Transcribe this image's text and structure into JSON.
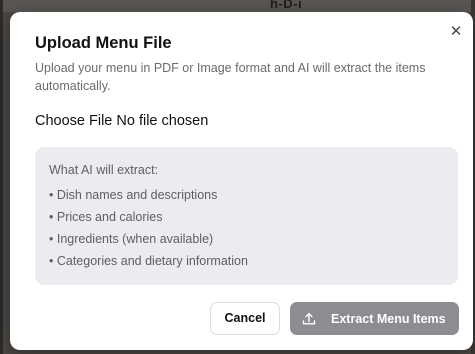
{
  "background": {
    "peek_text": "h-D-i"
  },
  "dialog": {
    "title": "Upload Menu File",
    "description": "Upload your menu in PDF or Image format and AI will extract the items automatically.",
    "close_icon": "close-icon",
    "file_input": {
      "button_label": "Choose File",
      "status": "No file chosen"
    },
    "info": {
      "heading": "What AI will extract:",
      "items": [
        "Dish names and descriptions",
        "Prices and calories",
        "Ingredients (when available)",
        "Categories and dietary information"
      ]
    },
    "buttons": {
      "cancel_label": "Cancel",
      "extract_label": "Extract Menu Items",
      "extract_icon": "upload-icon",
      "extract_disabled": true
    }
  },
  "colors": {
    "extract_button_bg": "#8c8c93",
    "info_box_bg": "#ecebf0",
    "backdrop": "#4a4744"
  }
}
